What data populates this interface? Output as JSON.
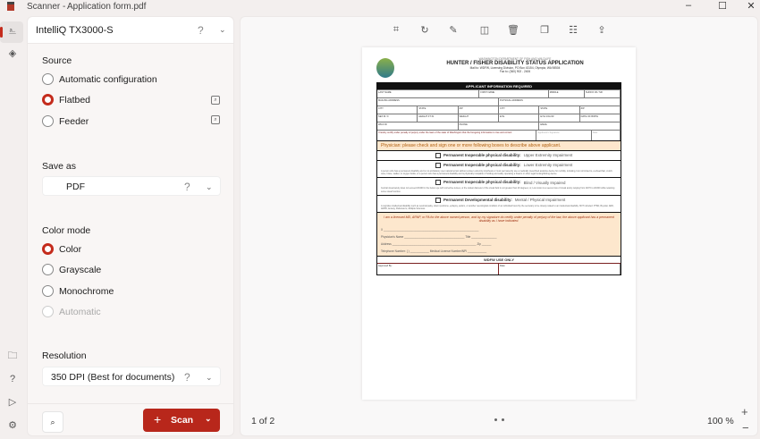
{
  "window": {
    "app": "Scanner -",
    "file": "Application form.pdf",
    "minimize": "–",
    "maximize": "☐",
    "close": "✕"
  },
  "rail": {
    "scan_icon": "⎁",
    "layers_icon": "◈",
    "folder_icon": "🗀",
    "help": "?",
    "feedback_icon": "▷",
    "settings_icon": "⚙"
  },
  "device": {
    "name": "IntelliQ TX3000-S",
    "help": "?",
    "chevron": "⌄"
  },
  "source": {
    "label": "Source",
    "options": [
      {
        "label": "Automatic configuration",
        "selected": false
      },
      {
        "label": "Flatbed",
        "selected": true
      },
      {
        "label": "Feeder",
        "selected": false
      }
    ]
  },
  "save_as": {
    "label": "Save as",
    "value": "PDF",
    "help": "?",
    "chevron": "⌄"
  },
  "color_mode": {
    "label": "Color mode",
    "options": [
      {
        "label": "Color",
        "selected": true
      },
      {
        "label": "Grayscale",
        "selected": false
      },
      {
        "label": "Monochrome",
        "selected": false
      },
      {
        "label": "Automatic",
        "selected": false,
        "disabled": true
      }
    ]
  },
  "resolution": {
    "label": "Resolution",
    "value": "350 DPI (Best for documents)",
    "help": "?",
    "chevron": "⌄"
  },
  "footer": {
    "preview_icon": "⌕",
    "scan_label": "Scan",
    "scan_plus": "+",
    "scan_chevron": "⌄",
    "accent": "#b8271b"
  },
  "toolbar": [
    "crop",
    "rotate",
    "markup",
    "split",
    "delete",
    "copy",
    "reorder",
    "share"
  ],
  "document": {
    "agency": "WASHINGTON DEPARTMENT OF FISH AND WILDLIFE",
    "title": "HUNTER / FISHER  DISABILITY STATUS APPLICATION",
    "mail": "Mail to:  WDFW, Licensing Division,  PO Box 43154, Olympia, WA  98504",
    "fax": "Fax to:  (360) 902 - 2406",
    "logo_text": "FISH and WILDLIFE",
    "print": "Please Print Clearly",
    "applicant_header": "APPLICANT INFORMATION REQUIRED",
    "fields": [
      [
        "LAST NAME",
        "FIRST NAME",
        "MIDDLE",
        "SUFFIX JR / SR"
      ],
      [
        "MAILING ADDRESS",
        "PHYSICAL ADDRESS"
      ],
      [
        "CITY",
        "STATE",
        "ZIP",
        "CITY",
        "STATE",
        "ZIP"
      ],
      [
        "SEX M / F",
        "HEIGHT FT IN",
        "WEIGHT",
        "EYE",
        "EYE COLOR",
        "DATE OF BIRTH"
      ],
      [
        "WILD ID",
        "PHONE",
        "EMAIL"
      ]
    ],
    "certify": "I hereby certify under penalty of perjury under the laws of the state of Washington that the foregoing information is true and correct.",
    "applicant_signature": "Applicant's Signature",
    "date": "Date",
    "physician_banner": "Physician:  please check and sign one or more following boxes to describe above applicant.",
    "physician_signature": "Physician Signature",
    "categories": [
      {
        "title": "Permanent Inoperable physical disability:",
        "sub": "Upper Extremity Impairment"
      },
      {
        "title": "Permanent Inoperable physical disability:",
        "sub": "Lower Extremity Impairment",
        "desc": "A person who has a permanent disability and is not ambulatory over natural terrain without a lower extremity prosthesis or must permanently use a medically prescribed assistive device for mobility, including, but not limited to, a wheelchair, crutch, cane, brace, walker, or oxygen bottle; or a person who has a permanent disability and is physically incapable of holding and safely operating a firearm or other legal hunting/fishing device."
      },
      {
        "title": "Permanent Inoperable physical disability:",
        "sub": "Blind / Visually Impaired",
        "desc": "Central visual acuity does not exceed 20/200 in the better eye with corrective lenses, or the widest diameter of the visual field is not greater than 20 degrees; or, Low vision is a severe loss of visual acuity ranging from 20/70 to 20/200 while retaining some visual function."
      },
      {
        "title": "Permanent Developmental disability:",
        "sub": "Mental / Physical Impairment",
        "desc": "A cognitive intellectual disability such as cerebral palsy, down syndrome, epilepsy, autism, or another neurological condition of an individual found by the secretary to be closely related to an intellectual disability.  NOT included: PTSD, Bi-polar, ADD, ADHD, Anxiety, Parkinson's, Multiple Sclerosis."
      }
    ],
    "attest": "I am a licensed MD, ARNP, or PA for the above named person, and by my signature do certify under penalty of perjury of the law, the above applicant has a permanent disability as I have indicated.",
    "x_mark": "X",
    "physician_name": "Physician's Name",
    "title_field": "Title",
    "address": "Address",
    "zip": "Zip",
    "telephone": "Telephone Number:  (        )",
    "license": "Medical License Number/NPI",
    "wdfw_only": "WDFW USE ONLY",
    "approved_by": "Approved By:",
    "date_field": "Date:"
  },
  "viewer": {
    "page_indicator": "1 of 2",
    "zoom": "100 %",
    "zoom_in": "+",
    "zoom_out": "−"
  }
}
